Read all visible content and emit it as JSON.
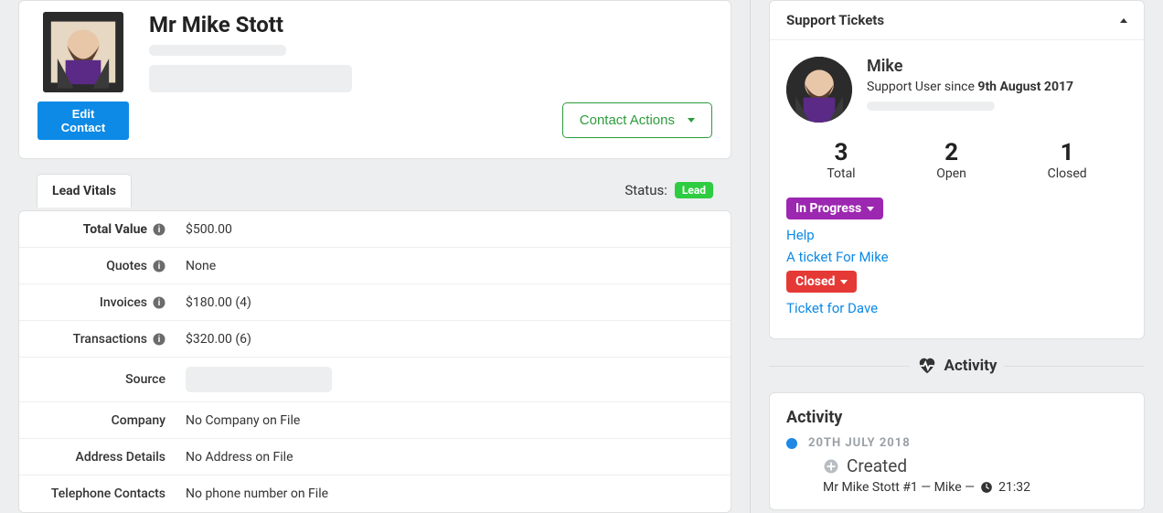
{
  "header": {
    "name": "Mr Mike Stott",
    "edit_label": "Edit Contact",
    "actions_label": "Contact Actions"
  },
  "vitals": {
    "tab_label": "Lead Vitals",
    "status_label": "Status:",
    "status_badge": "Lead",
    "rows": {
      "total_value": {
        "label": "Total Value",
        "value": "$500.00"
      },
      "quotes": {
        "label": "Quotes",
        "value": "None"
      },
      "invoices": {
        "label": "Invoices",
        "value": "$180.00 (4)"
      },
      "transactions": {
        "label": "Transactions",
        "value": "$320.00 (6)"
      },
      "source": {
        "label": "Source",
        "value": ""
      },
      "company": {
        "label": "Company",
        "value": "No Company on File"
      },
      "address": {
        "label": "Address Details",
        "value": "No Address on File"
      },
      "telephone": {
        "label": "Telephone Contacts",
        "value": "No phone number on File"
      }
    }
  },
  "support": {
    "panel_title": "Support Tickets",
    "user_name": "Mike",
    "since_prefix": "Support User since ",
    "since_date": "9th August 2017",
    "stats": {
      "total": {
        "num": "3",
        "label": "Total"
      },
      "open": {
        "num": "2",
        "label": "Open"
      },
      "closed": {
        "num": "1",
        "label": "Closed"
      }
    },
    "groups": [
      {
        "tag": "In Progress",
        "color": "purple",
        "items": [
          "Help",
          "A ticket For Mike"
        ]
      },
      {
        "tag": "Closed",
        "color": "red",
        "items": [
          "Ticket for Dave"
        ]
      }
    ]
  },
  "activity": {
    "divider_label": "Activity",
    "heading": "Activity",
    "date": "20TH JULY 2018",
    "event_title": "Created",
    "event_sub": "Mr Mike Stott #1 — Mike —",
    "event_time": "21:32"
  }
}
